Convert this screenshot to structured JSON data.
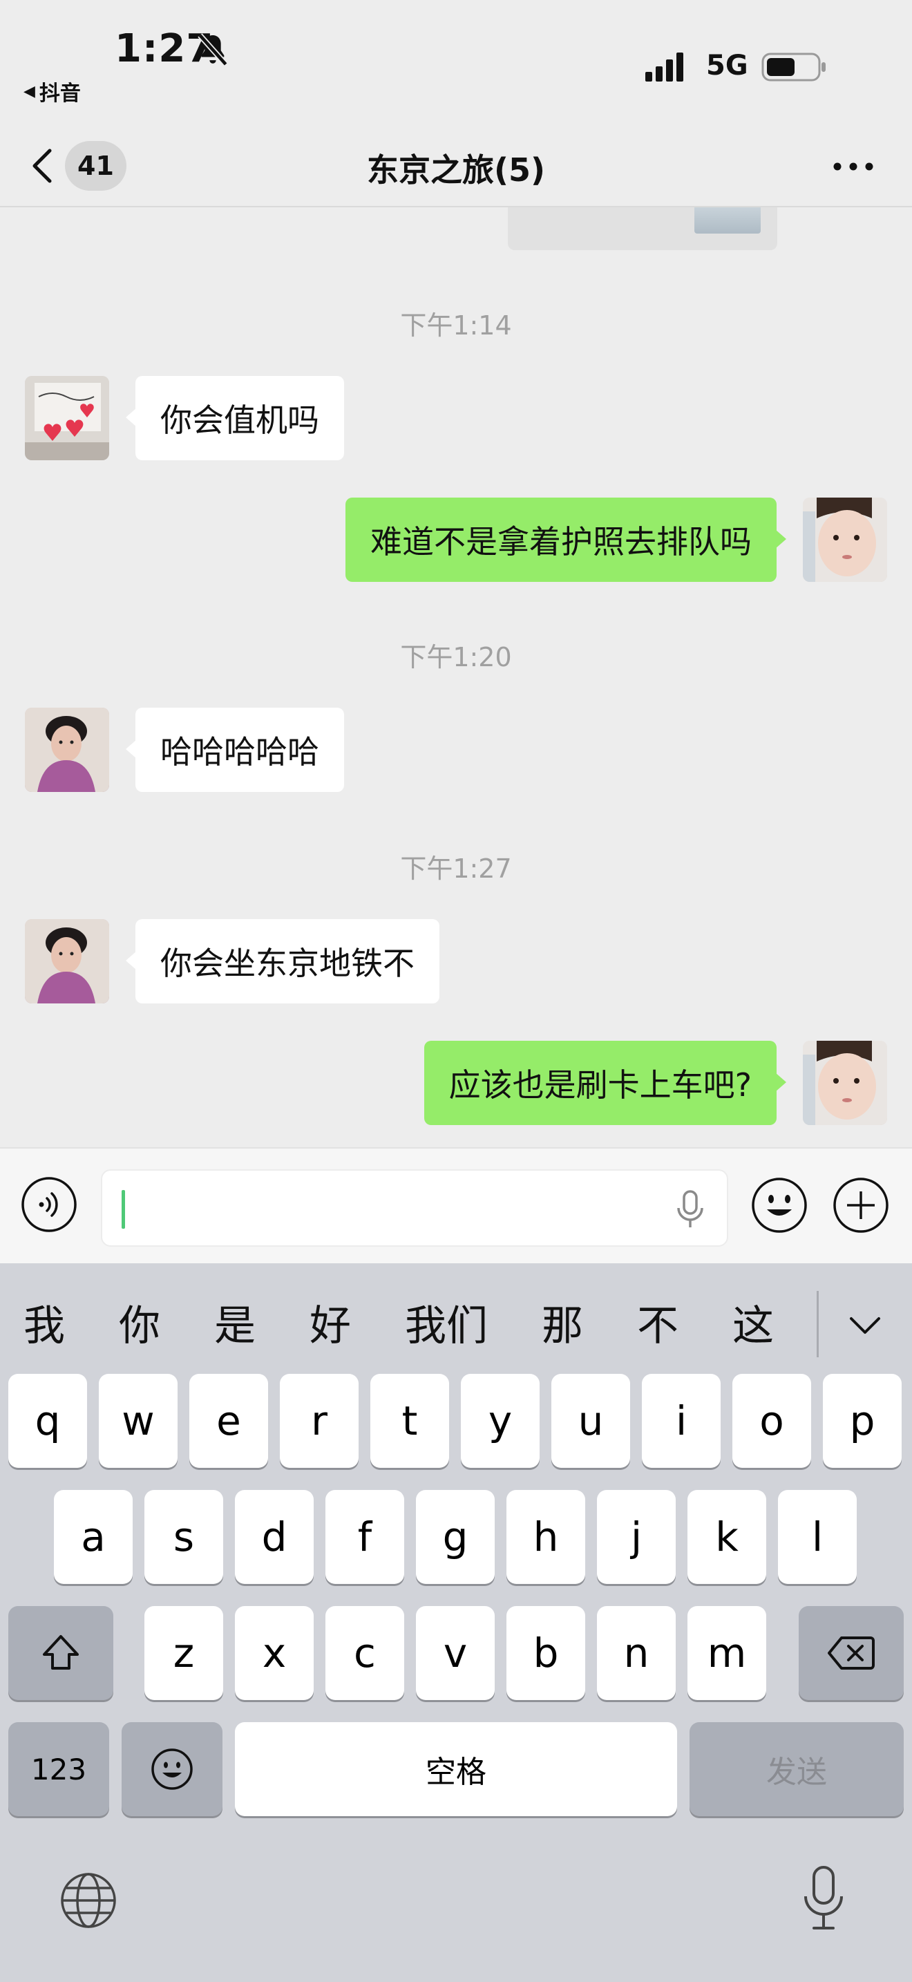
{
  "status_bar": {
    "time": "1:27",
    "back_app": "抖音",
    "network": "5G"
  },
  "nav": {
    "unread_count": "41",
    "title": "东京之旅(5)"
  },
  "messages": [
    {
      "type": "time",
      "text": "下午1:14"
    },
    {
      "type": "incoming",
      "text": "你会值机吗"
    },
    {
      "type": "outgoing",
      "text": "难道不是拿着护照去排队吗"
    },
    {
      "type": "time",
      "text": "下午1:20"
    },
    {
      "type": "incoming",
      "text": "哈哈哈哈哈"
    },
    {
      "type": "time",
      "text": "下午1:27"
    },
    {
      "type": "incoming",
      "text": "你会坐东京地铁不"
    },
    {
      "type": "outgoing",
      "text": "应该也是刷卡上车吧?"
    }
  ],
  "input": {
    "value": ""
  },
  "keyboard": {
    "candidates": [
      "我",
      "你",
      "是",
      "好",
      "我们",
      "那",
      "不",
      "这"
    ],
    "row1": [
      "q",
      "w",
      "e",
      "r",
      "t",
      "y",
      "u",
      "i",
      "o",
      "p"
    ],
    "row2": [
      "a",
      "s",
      "d",
      "f",
      "g",
      "h",
      "j",
      "k",
      "l"
    ],
    "row3": [
      "z",
      "x",
      "c",
      "v",
      "b",
      "n",
      "m"
    ],
    "numbers_label": "123",
    "space_label": "空格",
    "send_label": "发送"
  },
  "colors": {
    "background": "#ededed",
    "outgoing_bubble": "#95ec69",
    "incoming_bubble": "#ffffff",
    "keyboard_bg": "#d1d3d9",
    "caret": "#4fc977"
  }
}
